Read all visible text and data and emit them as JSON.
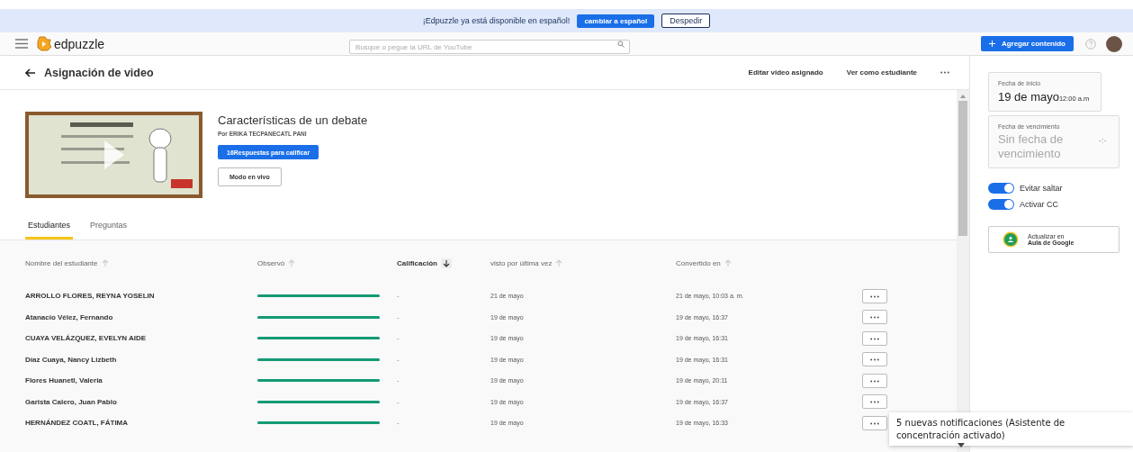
{
  "banner": {
    "message": "¡Edpuzzle ya está disponible en español!",
    "primary_button": "cambiar a español",
    "secondary_button": "Despedir"
  },
  "header": {
    "logo_text": "edpuzzle",
    "search": {
      "placeholder": "Busque o pegue la URL de YouTube"
    },
    "add_button": "Agregar contenido"
  },
  "page_title": "Asignación de video",
  "actions": [
    "Editar video asignado",
    "Ver como estudiante"
  ],
  "video": {
    "kind": "picture",
    "title": "Características de un debate",
    "author": "Por ERIKA TECPANECATL PANI",
    "grade_button": "16Respuestas para calificar",
    "live_button": "Modo en vivo"
  },
  "tabs": [
    {
      "label": "Estudiantes",
      "selected": true
    },
    {
      "label": "Preguntas",
      "selected": false
    }
  ],
  "table": {
    "columns": [
      {
        "label": "Nombre del estudiante",
        "sorted": false
      },
      {
        "label": "Observó",
        "sorted": false
      },
      {
        "label": "Calificación",
        "sorted": true
      },
      {
        "label": "visto por última vez",
        "sorted": false
      },
      {
        "label": "Convertido en",
        "sorted": false
      }
    ],
    "rows": [
      {
        "name": "ARROLLO FLORES, REYNA YOSELIN",
        "level": 1,
        "grade": "-",
        "last_seen": "21 de mayo",
        "turned_in": "21 de mayo, 10:03 a. m."
      },
      {
        "name": "Atanacio Vélez, Fernando",
        "level": 1,
        "grade": "-",
        "last_seen": "19 de mayo",
        "turned_in": "19 de mayo, 16:37"
      },
      {
        "name": "CUAYA VELÁZQUEZ, EVELYN AIDE",
        "level": 1,
        "grade": "-",
        "last_seen": "19 de mayo",
        "turned_in": "19 de mayo, 16:31"
      },
      {
        "name": "Díaz Cuaya, Nancy Lizbeth",
        "level": 1,
        "grade": "-",
        "last_seen": "19 de mayo",
        "turned_in": "19 de mayo, 16:31"
      },
      {
        "name": "Flores Huanetl, Valeria",
        "level": 1,
        "grade": "-",
        "last_seen": "19 de mayo",
        "turned_in": "19 de mayo, 20:11"
      },
      {
        "name": "Garista Calero, Juan Pablo",
        "level": 1,
        "grade": "-",
        "last_seen": "19 de mayo",
        "turned_in": "19 de mayo, 16:37"
      },
      {
        "name": "HERNÁNDEZ COATL, FÁTIMA",
        "level": 1,
        "grade": "-",
        "last_seen": "19 de mayo",
        "turned_in": "19 de mayo, 16:33"
      }
    ]
  },
  "sidebar": {
    "start_date": {
      "label": "Fecha de inicio",
      "date": "19 de mayo",
      "time": "12:00 a.m"
    },
    "due_date": {
      "label": "Fecha de vencimiento",
      "placeholder": "Sin fecha de vencimiento",
      "time_placeholder": "-:-"
    },
    "toggles": [
      {
        "label": "Evitar saltar",
        "on": true
      },
      {
        "label": "Activar CC",
        "on": true
      }
    ],
    "classroom_button": [
      "Actualizar en",
      "Aula de Google"
    ]
  },
  "notification": "5 nuevas notificaciones (Asistente de concentración activado)"
}
